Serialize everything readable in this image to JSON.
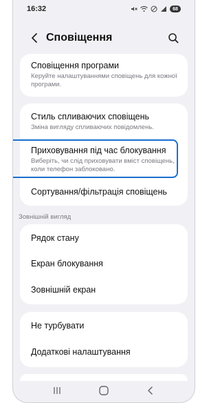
{
  "status_bar": {
    "time": "16:32",
    "battery": "68"
  },
  "app_bar": {
    "title": "Сповіщення"
  },
  "groups": [
    {
      "items": [
        {
          "title": "Сповіщення програми",
          "subtitle": "Керуйте налаштуваннями сповіщень для кожної програми."
        }
      ]
    },
    {
      "items": [
        {
          "title": "Стиль спливаючих сповіщень",
          "subtitle": "Зміна вигляду спливаючих повідомлень."
        },
        {
          "title": "Приховування під час блокування",
          "subtitle": "Виберіть, чи слід приховувати вміст сповіщень, коли телефон заблоковано."
        },
        {
          "title": "Сортування/фільтрація сповіщень"
        }
      ]
    },
    {
      "label": "Зовнішній вигляд",
      "items": [
        {
          "title": "Рядок стану"
        },
        {
          "title": "Екран блокування"
        },
        {
          "title": "Зовнішній екран"
        }
      ]
    },
    {
      "items": [
        {
          "title": "Не турбувати"
        },
        {
          "title": "Додаткові налаштування"
        }
      ]
    }
  ],
  "icons": {
    "back": "chevron-left-icon",
    "search": "search-icon",
    "nav_recents": "recents-icon",
    "nav_home": "home-icon",
    "nav_back": "back-icon"
  },
  "colors": {
    "highlight": "#1a6fd1",
    "background": "#f1f1f5",
    "card": "#ffffff"
  }
}
